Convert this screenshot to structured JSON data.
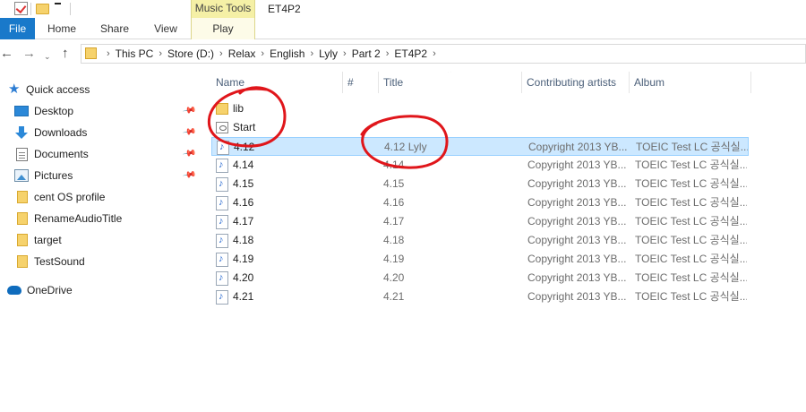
{
  "titlebar": {
    "contextual_group": "Music Tools",
    "title": "ET4P2"
  },
  "ribbon": {
    "tabs": [
      "File",
      "Home",
      "Share",
      "View",
      "Play"
    ]
  },
  "address": {
    "crumbs": [
      "This PC",
      "Store (D:)",
      "Relax",
      "English",
      "Lyly",
      "Part 2",
      "ET4P2"
    ]
  },
  "navpane": {
    "quick_access": "Quick access",
    "items": [
      {
        "label": "Desktop",
        "icon": "desktop-icon",
        "pinned": true
      },
      {
        "label": "Downloads",
        "icon": "download-icon",
        "pinned": true
      },
      {
        "label": "Documents",
        "icon": "documents-icon",
        "pinned": true
      },
      {
        "label": "Pictures",
        "icon": "pictures-icon",
        "pinned": true
      },
      {
        "label": "cent OS profile",
        "icon": "folder-icon",
        "pinned": false
      },
      {
        "label": "RenameAudioTitle",
        "icon": "folder-icon",
        "pinned": false
      },
      {
        "label": "target",
        "icon": "folder-icon",
        "pinned": false
      },
      {
        "label": "TestSound",
        "icon": "folder-icon",
        "pinned": false
      }
    ],
    "onedrive": "OneDrive"
  },
  "filelist": {
    "columns": [
      "Name",
      "#",
      "Title",
      "Contributing artists",
      "Album"
    ],
    "rows": [
      {
        "name": "lib",
        "type": "folder",
        "title": "",
        "artists": "",
        "album": ""
      },
      {
        "name": "Start",
        "type": "shortcut",
        "title": "",
        "artists": "",
        "album": ""
      },
      {
        "name": "4.12",
        "type": "audio",
        "title": "4.12 Lyly",
        "artists": "Copyright 2013 YB...",
        "album": "TOEIC Test LC 공식실...",
        "selected": true
      },
      {
        "name": "4.14",
        "type": "audio",
        "title": "4.14",
        "artists": "Copyright 2013 YB...",
        "album": "TOEIC Test LC 공식실..."
      },
      {
        "name": "4.15",
        "type": "audio",
        "title": "4.15",
        "artists": "Copyright 2013 YB...",
        "album": "TOEIC Test LC 공식실..."
      },
      {
        "name": "4.16",
        "type": "audio",
        "title": "4.16",
        "artists": "Copyright 2013 YB...",
        "album": "TOEIC Test LC 공식실..."
      },
      {
        "name": "4.17",
        "type": "audio",
        "title": "4.17",
        "artists": "Copyright 2013 YB...",
        "album": "TOEIC Test LC 공식실..."
      },
      {
        "name": "4.18",
        "type": "audio",
        "title": "4.18",
        "artists": "Copyright 2013 YB...",
        "album": "TOEIC Test LC 공식실..."
      },
      {
        "name": "4.19",
        "type": "audio",
        "title": "4.19",
        "artists": "Copyright 2013 YB...",
        "album": "TOEIC Test LC 공식실..."
      },
      {
        "name": "4.20",
        "type": "audio",
        "title": "4.20",
        "artists": "Copyright 2013 YB...",
        "album": "TOEIC Test LC 공식실..."
      },
      {
        "name": "4.21",
        "type": "audio",
        "title": "4.21",
        "artists": "Copyright 2013 YB...",
        "album": "TOEIC Test LC 공식실..."
      }
    ]
  },
  "colors": {
    "file_tab": "#1979ca",
    "selection": "#cce8ff",
    "contextual_tab": "#f5f0a6",
    "annotation": "#e0161b"
  }
}
